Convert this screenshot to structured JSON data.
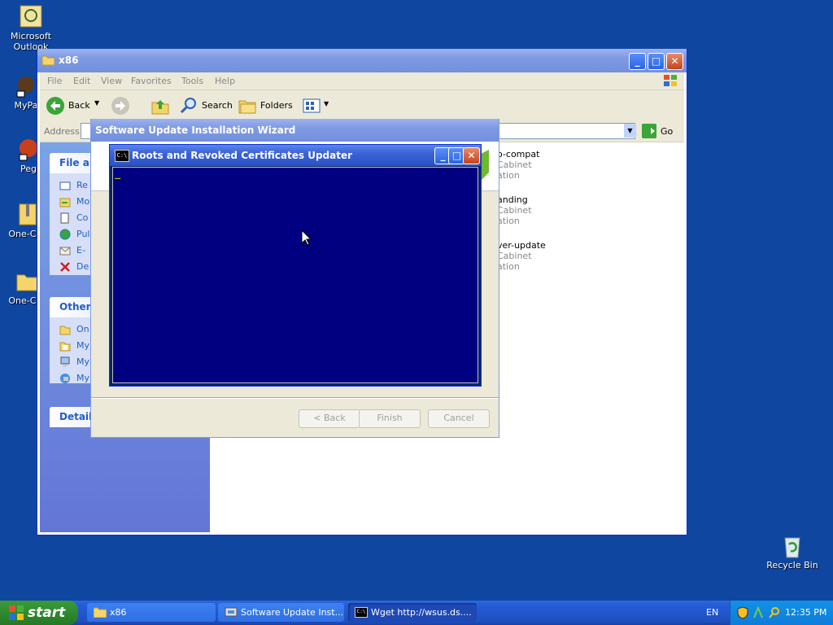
{
  "desktop": {
    "icons": [
      {
        "label": "Microsoft Outlook"
      },
      {
        "label": "MyPa"
      },
      {
        "label": "Peg"
      },
      {
        "label": "One-Cor"
      },
      {
        "label": "One-Cor"
      }
    ],
    "recycle_bin": "Recycle Bin"
  },
  "explorer": {
    "title": "x86",
    "menu": [
      "File",
      "Edit",
      "View",
      "Favorites",
      "Tools",
      "Help"
    ],
    "toolbar": {
      "back": "Back",
      "search": "Search",
      "folders": "Folders"
    },
    "address_label": "Address",
    "go_label": "Go",
    "file_tasks": {
      "header": "File an",
      "items": [
        "Re",
        "Mo",
        "Co",
        "Pul",
        "E-",
        "De"
      ]
    },
    "other_places": {
      "header": "Other",
      "items": [
        "On",
        "My",
        "My",
        "My"
      ]
    },
    "details_header": "Details",
    "files": [
      {
        "name": "o-compat",
        "type": "Cabinet",
        "sub": "ation"
      },
      {
        "name": "anding",
        "type": "Cabinet",
        "sub": "ation"
      },
      {
        "name": "ver-update",
        "type": "Cabinet",
        "sub": "ation"
      }
    ]
  },
  "wizard": {
    "title": "Software Update Installation Wizard",
    "back": "< Back",
    "finish": "Finish",
    "cancel": "Cancel"
  },
  "console": {
    "title": "Roots and Revoked Certificates Updater",
    "icon_text": "C:\\",
    "cursor": "_"
  },
  "taskbar": {
    "start": "start",
    "buttons": [
      {
        "label": "x86"
      },
      {
        "label": "Software Update Inst..."
      },
      {
        "label": "Wget http://wsus.ds...."
      }
    ],
    "language": "EN",
    "clock": "12:35 PM"
  },
  "colors": {
    "desktop": "#0f46a0",
    "console_bg": "#000080",
    "title_active": "#2a52c6",
    "title_inactive": "#7f9ae3"
  }
}
